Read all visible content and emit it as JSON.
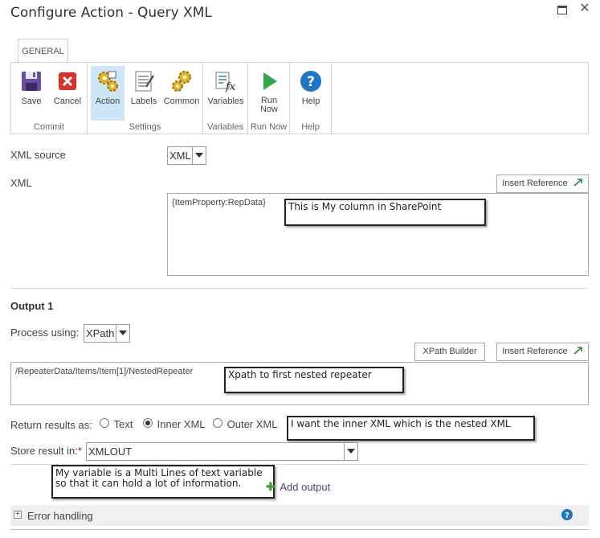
{
  "window": {
    "title": "Configure Action - Query XML"
  },
  "ribbon": {
    "tab": "GENERAL",
    "buttons": {
      "save": "Save",
      "cancel": "Cancel",
      "action": "Action",
      "labels": "Labels",
      "common": "Common",
      "variables": "Variables",
      "run_now": "Run\nNow",
      "help": "Help"
    },
    "groups": {
      "commit": "Commit",
      "settings": "Settings",
      "variables": "Variables",
      "run_now": "Run Now",
      "help": "Help"
    }
  },
  "form": {
    "xml_source_label": "XML source",
    "xml_source_value": "XML",
    "xml_label": "XML",
    "insert_reference": "Insert Reference",
    "xml_value": "{ItemProperty:RepData}",
    "output_heading": "Output 1",
    "process_using_label": "Process using:",
    "process_using_value": "XPath",
    "xpath_builder": "XPath Builder",
    "xpath_value": "/RepeaterData/Items/Item[1]/NestedRepeater",
    "return_results_label": "Return results as:",
    "radio_text": "Text",
    "radio_inner_xml": "Inner XML",
    "radio_outer_xml": "Outer XML",
    "store_result_label": "Store result in:",
    "required_mark": "*",
    "store_result_value": "XMLOUT",
    "add_output": "Add output",
    "error_handling": "Error handling"
  },
  "annotations": {
    "xml_note": "This is My column in SharePoint",
    "xpath_note": "Xpath to first nested repeater",
    "inner_note": "I want the inner XML which is the nested XML",
    "variable_note": "My variable is a Multi Lines of text variable so that it can hold a lot of information."
  },
  "colors": {
    "accent": "#0072c6",
    "active_button": "#cde6f7",
    "add_icon": "#3aa02e",
    "link": "#5a3b8c"
  }
}
